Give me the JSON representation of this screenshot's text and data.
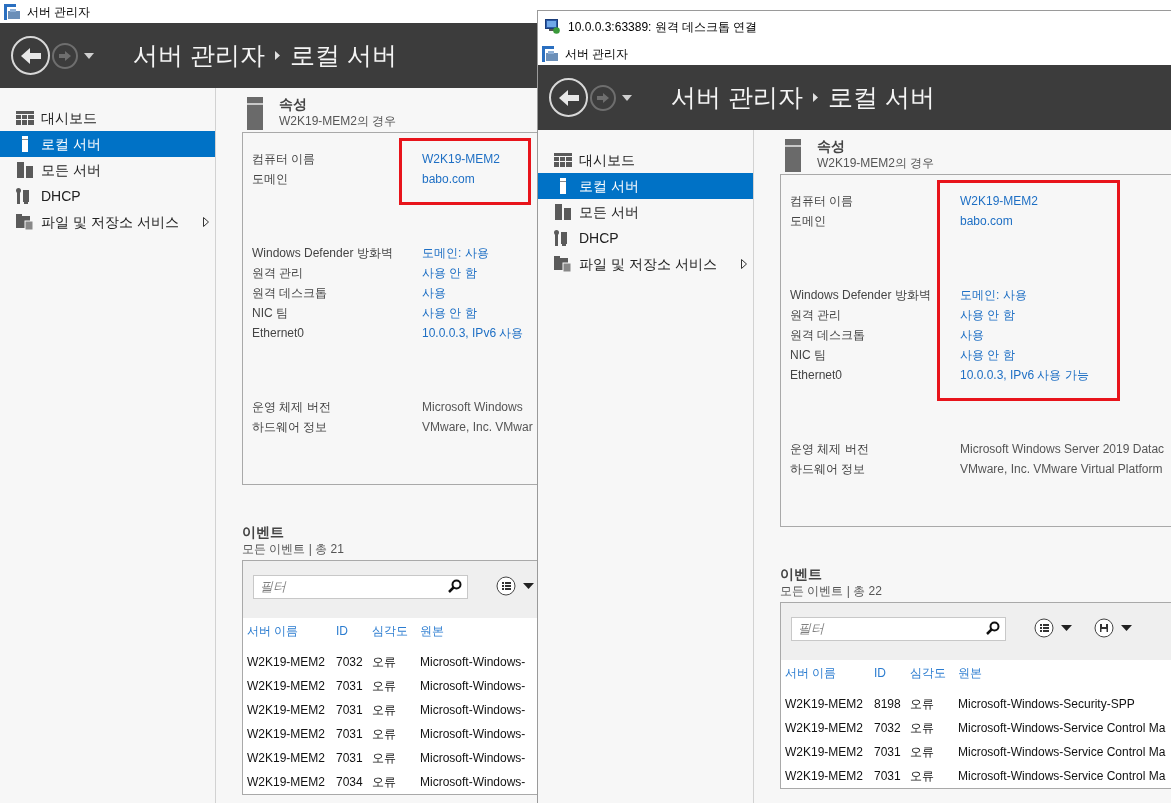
{
  "server_manager_window": {
    "title": "서버 관리자",
    "breadcrumb": [
      "서버 관리자",
      "로컬 서버"
    ],
    "nav": [
      {
        "kind": "dashboard",
        "label": "대시보드",
        "selected": false,
        "submenu": false
      },
      {
        "kind": "local_server",
        "label": "로컬 서버",
        "selected": true,
        "submenu": false
      },
      {
        "kind": "all_servers",
        "label": "모든 서버",
        "selected": false,
        "submenu": false
      },
      {
        "kind": "tools",
        "label": "DHCP",
        "selected": false,
        "submenu": false
      },
      {
        "kind": "files",
        "label": "파일 및 저장소 서비스",
        "selected": false,
        "submenu": true
      }
    ],
    "properties": {
      "title": "속성",
      "subtitle": "W2K19-MEM2의 경우",
      "groups": [
        {
          "highlighted": true,
          "rows": [
            {
              "label": "컴퓨터 이름",
              "value": "W2K19-MEM2",
              "link": true
            },
            {
              "label": "도메인",
              "value": "babo.com",
              "link": true
            }
          ]
        },
        {
          "highlighted": false,
          "rows": [
            {
              "label": "Windows Defender 방화벽",
              "value": "도메인: 사용",
              "link": true
            },
            {
              "label": "원격 관리",
              "value": "사용 안 함",
              "link": true
            },
            {
              "label": "원격 데스크톱",
              "value": "사용",
              "link": true
            },
            {
              "label": "NIC 팀",
              "value": "사용 안 함",
              "link": true
            },
            {
              "label": "Ethernet0",
              "value": "10.0.0.3, IPv6 사용",
              "link": true
            }
          ]
        },
        {
          "highlighted": false,
          "rows": [
            {
              "label": "운영 체제 버전",
              "value": "Microsoft Windows",
              "link": false
            },
            {
              "label": "하드웨어 정보",
              "value": "VMware, Inc. VMwar",
              "link": false
            }
          ]
        }
      ]
    },
    "events": {
      "title": "이벤트",
      "subtitle": "모든 이벤트 | 총 21",
      "filter_placeholder": "필터",
      "tools": [
        {
          "kind": "list"
        }
      ],
      "columns": [
        "서버 이름",
        "ID",
        "심각도",
        "원본"
      ],
      "rows": [
        [
          "W2K19-MEM2",
          "7032",
          "오류",
          "Microsoft-Windows-"
        ],
        [
          "W2K19-MEM2",
          "7031",
          "오류",
          "Microsoft-Windows-"
        ],
        [
          "W2K19-MEM2",
          "7031",
          "오류",
          "Microsoft-Windows-"
        ],
        [
          "W2K19-MEM2",
          "7031",
          "오류",
          "Microsoft-Windows-"
        ],
        [
          "W2K19-MEM2",
          "7031",
          "오류",
          "Microsoft-Windows-"
        ],
        [
          "W2K19-MEM2",
          "7034",
          "오류",
          "Microsoft-Windows-"
        ]
      ]
    }
  },
  "remote_desktop_window": {
    "title": "10.0.0.3:63389: 원격 데스크톱 연결",
    "server_manager": {
      "title": "서버 관리자",
      "breadcrumb": [
        "서버 관리자",
        "로컬 서버"
      ],
      "nav": [
        {
          "kind": "dashboard",
          "label": "대시보드",
          "selected": false,
          "submenu": false
        },
        {
          "kind": "local_server",
          "label": "로컬 서버",
          "selected": true,
          "submenu": false
        },
        {
          "kind": "all_servers",
          "label": "모든 서버",
          "selected": false,
          "submenu": false
        },
        {
          "kind": "tools",
          "label": "DHCP",
          "selected": false,
          "submenu": false
        },
        {
          "kind": "files",
          "label": "파일 및 저장소 서비스",
          "selected": false,
          "submenu": true
        }
      ],
      "properties": {
        "title": "속성",
        "subtitle": "W2K19-MEM2의 경우",
        "groups": [
          {
            "highlighted": true,
            "rows": [
              {
                "label": "컴퓨터 이름",
                "value": "W2K19-MEM2",
                "link": true
              },
              {
                "label": "도메인",
                "value": "babo.com",
                "link": true
              }
            ]
          },
          {
            "highlighted": true,
            "rows": [
              {
                "label": "Windows Defender 방화벽",
                "value": "도메인: 사용",
                "link": true
              },
              {
                "label": "원격 관리",
                "value": "사용 안 함",
                "link": true
              },
              {
                "label": "원격 데스크톱",
                "value": "사용",
                "link": true
              },
              {
                "label": "NIC 팀",
                "value": "사용 안 함",
                "link": true
              },
              {
                "label": "Ethernet0",
                "value": "10.0.0.3, IPv6 사용 가능",
                "link": true
              }
            ]
          },
          {
            "highlighted": false,
            "rows": [
              {
                "label": "운영 체제 버전",
                "value": "Microsoft Windows Server 2019 Datac",
                "link": false
              },
              {
                "label": "하드웨어 정보",
                "value": "VMware, Inc. VMware Virtual Platform",
                "link": false
              }
            ]
          }
        ]
      },
      "events": {
        "title": "이벤트",
        "subtitle": "모든 이벤트 | 총 22",
        "filter_placeholder": "필터",
        "tools": [
          {
            "kind": "list"
          },
          {
            "kind": "save"
          }
        ],
        "columns": [
          "서버 이름",
          "ID",
          "심각도",
          "원본"
        ],
        "rows": [
          [
            "W2K19-MEM2",
            "8198",
            "오류",
            "Microsoft-Windows-Security-SPP"
          ],
          [
            "W2K19-MEM2",
            "7032",
            "오류",
            "Microsoft-Windows-Service Control Ma"
          ],
          [
            "W2K19-MEM2",
            "7031",
            "오류",
            "Microsoft-Windows-Service Control Ma"
          ],
          [
            "W2K19-MEM2",
            "7031",
            "오류",
            "Microsoft-Windows-Service Control Ma"
          ]
        ]
      }
    }
  }
}
